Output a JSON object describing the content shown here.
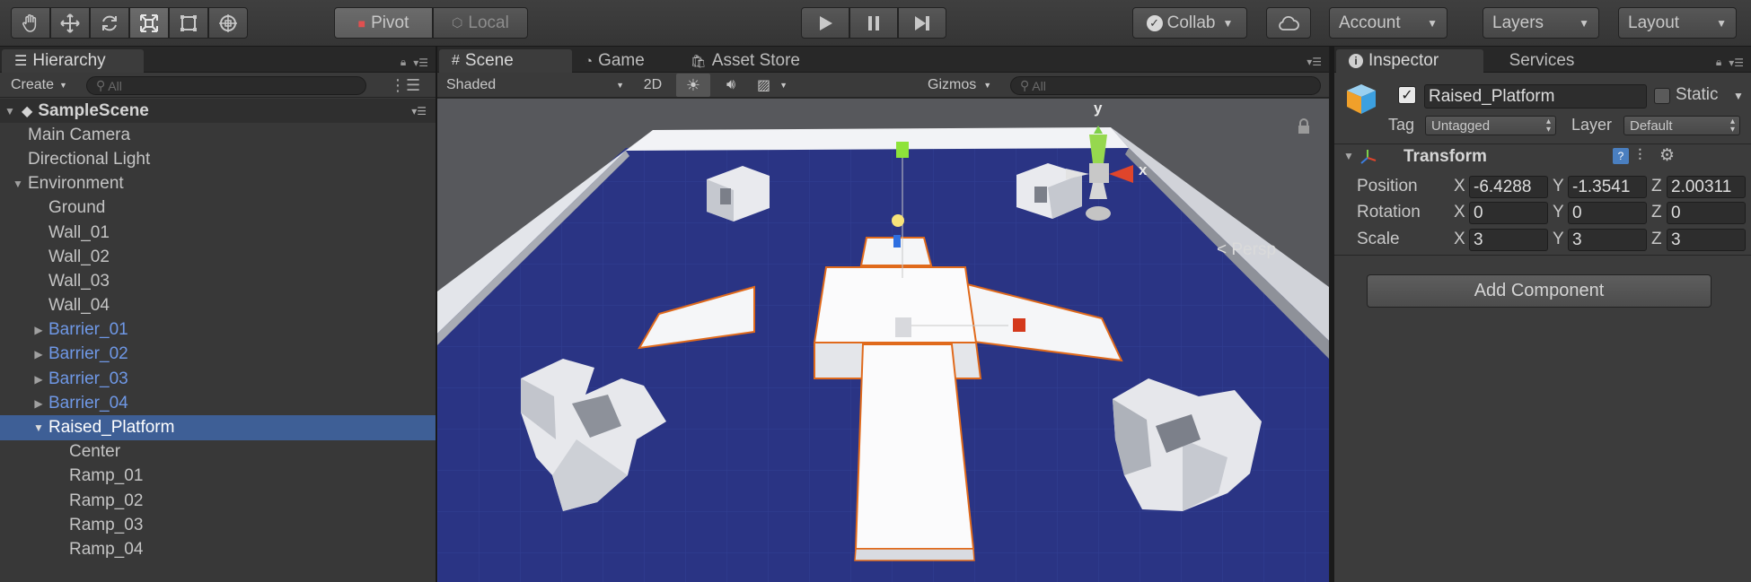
{
  "toolbar": {
    "tools": [
      "hand-tool",
      "move-tool",
      "rotate-tool",
      "scale-tool",
      "rect-tool",
      "transform-tool"
    ],
    "pivot_label": "Pivot",
    "local_label": "Local",
    "collab_label": "Collab",
    "account_label": "Account",
    "layers_label": "Layers",
    "layout_label": "Layout"
  },
  "hierarchy": {
    "tab_label": "Hierarchy",
    "create_label": "Create",
    "search_placeholder": "All",
    "scene_name": "SampleScene",
    "items": [
      {
        "label": "Main Camera",
        "depth": 1,
        "expander": "",
        "prefab": false,
        "selected": false
      },
      {
        "label": "Directional Light",
        "depth": 1,
        "expander": "",
        "prefab": false,
        "selected": false
      },
      {
        "label": "Environment",
        "depth": 1,
        "expander": "open",
        "prefab": false,
        "selected": false
      },
      {
        "label": "Ground",
        "depth": 2,
        "expander": "",
        "prefab": false,
        "selected": false
      },
      {
        "label": "Wall_01",
        "depth": 2,
        "expander": "",
        "prefab": false,
        "selected": false
      },
      {
        "label": "Wall_02",
        "depth": 2,
        "expander": "",
        "prefab": false,
        "selected": false
      },
      {
        "label": "Wall_03",
        "depth": 2,
        "expander": "",
        "prefab": false,
        "selected": false
      },
      {
        "label": "Wall_04",
        "depth": 2,
        "expander": "",
        "prefab": false,
        "selected": false
      },
      {
        "label": "Barrier_01",
        "depth": 2,
        "expander": "closed",
        "prefab": true,
        "selected": false
      },
      {
        "label": "Barrier_02",
        "depth": 2,
        "expander": "closed",
        "prefab": true,
        "selected": false
      },
      {
        "label": "Barrier_03",
        "depth": 2,
        "expander": "closed",
        "prefab": true,
        "selected": false
      },
      {
        "label": "Barrier_04",
        "depth": 2,
        "expander": "closed",
        "prefab": true,
        "selected": false
      },
      {
        "label": "Raised_Platform",
        "depth": 2,
        "expander": "open",
        "prefab": false,
        "selected": true
      },
      {
        "label": "Center",
        "depth": 3,
        "expander": "",
        "prefab": false,
        "selected": false
      },
      {
        "label": "Ramp_01",
        "depth": 3,
        "expander": "",
        "prefab": false,
        "selected": false
      },
      {
        "label": "Ramp_02",
        "depth": 3,
        "expander": "",
        "prefab": false,
        "selected": false
      },
      {
        "label": "Ramp_03",
        "depth": 3,
        "expander": "",
        "prefab": false,
        "selected": false
      },
      {
        "label": "Ramp_04",
        "depth": 3,
        "expander": "",
        "prefab": false,
        "selected": false
      }
    ]
  },
  "scene": {
    "tabs": [
      {
        "label": "Scene",
        "icon": "scene-grid-icon",
        "active": true
      },
      {
        "label": "Game",
        "icon": "pacman-icon",
        "active": false
      },
      {
        "label": "Asset Store",
        "icon": "bag-icon",
        "active": false
      }
    ],
    "shading_label": "Shaded",
    "mode_2d_label": "2D",
    "gizmos_label": "Gizmos",
    "search_placeholder": "All",
    "persp_label": "< Persp",
    "axis_y": "y",
    "axis_x": "x"
  },
  "inspector": {
    "tabs": [
      {
        "label": "Inspector",
        "active": true
      },
      {
        "label": "Services",
        "active": false
      }
    ],
    "object_name": "Raised_Platform",
    "active": true,
    "static_label": "Static",
    "static": false,
    "tag_label": "Tag",
    "tag_value": "Untagged",
    "layer_label": "Layer",
    "layer_value": "Default",
    "transform": {
      "title": "Transform",
      "rows": [
        {
          "label": "Position",
          "x": "-6.4288",
          "y": "-1.3541",
          "z": "2.00311"
        },
        {
          "label": "Rotation",
          "x": "0",
          "y": "0",
          "z": "0"
        },
        {
          "label": "Scale",
          "x": "3",
          "y": "3",
          "z": "3"
        }
      ],
      "axis_labels": [
        "X",
        "Y",
        "Z"
      ]
    },
    "add_component_label": "Add Component"
  },
  "colors": {
    "selection": "#3e5f96",
    "prefab_text": "#6f98e6",
    "floor": "#2a3484",
    "outline": "#e06a1c"
  }
}
